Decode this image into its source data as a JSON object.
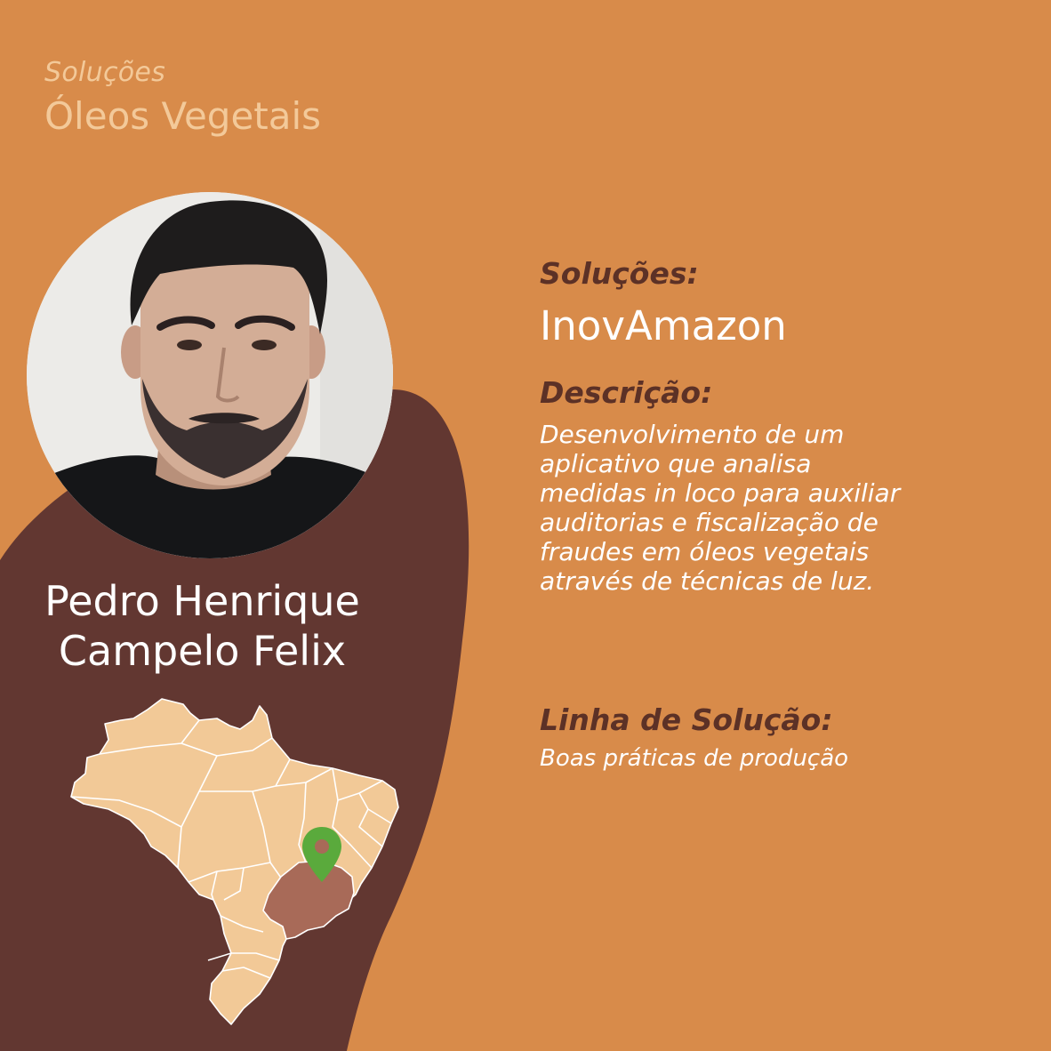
{
  "header": {
    "kicker": "Soluções",
    "title": "Óleos Vegetais"
  },
  "person": {
    "name_line1": "Pedro Henrique",
    "name_line2": "Campelo Felix",
    "photo_icon": "person-photo"
  },
  "map": {
    "icon": "brazil-map",
    "highlight_icon": "minas-gerais-region",
    "marker_icon": "location-pin-icon"
  },
  "solution": {
    "label": "Soluções:",
    "name": "InovAmazon"
  },
  "description": {
    "label": "Descrição:",
    "lines": [
      "Desenvolvimento de um",
      "aplicativo que analisa",
      "medidas in loco para auxiliar",
      "auditorias e fiscalização de",
      "fraudes em óleos vegetais",
      "através de técnicas de luz."
    ]
  },
  "solution_line": {
    "label": "Linha de Solução:",
    "value": "Boas práticas de produção"
  },
  "colors": {
    "background": "#d88b4a",
    "blob": "#623731",
    "accent_text": "#f3c999",
    "label_text": "#5c3126",
    "map_fill": "#f2c997",
    "map_highlight": "#a86a58",
    "pin": "#5aaa3c"
  }
}
